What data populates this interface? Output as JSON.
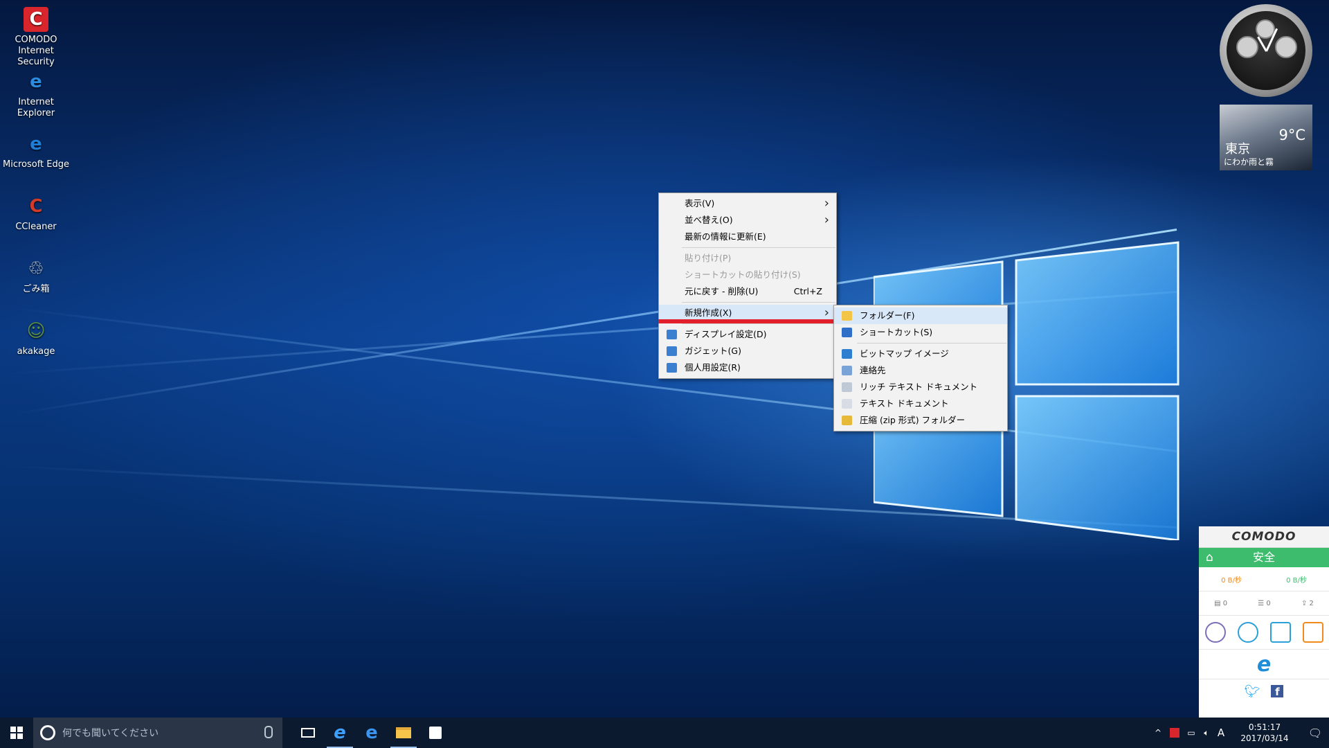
{
  "desktop_icons": [
    {
      "label": "COMODO\nInternet Security",
      "icon": "comodo-icon",
      "color": "#d9262c"
    },
    {
      "label": "Internet Explorer",
      "icon": "internet-explorer-icon",
      "color": "#2b8be0"
    },
    {
      "label": "Microsoft Edge",
      "icon": "edge-icon",
      "color": "#1f7ed6"
    },
    {
      "label": "CCleaner",
      "icon": "ccleaner-icon",
      "color": "#d23b2a"
    },
    {
      "label": "ごみ箱",
      "icon": "recycle-bin-icon",
      "color": "#cfd8e3"
    },
    {
      "label": "akakage",
      "icon": "user-icon",
      "color": "#5a8f4a"
    }
  ],
  "context_menu": {
    "items": [
      {
        "label": "表示(V)",
        "submenu": true
      },
      {
        "label": "並べ替え(O)",
        "submenu": true
      },
      {
        "label": "最新の情報に更新(E)"
      },
      {
        "separator": true
      },
      {
        "label": "貼り付け(P)",
        "disabled": true
      },
      {
        "label": "ショートカットの貼り付け(S)",
        "disabled": true
      },
      {
        "label": "元に戻す - 削除(U)",
        "accelerator": "Ctrl+Z"
      },
      {
        "separator": true
      },
      {
        "label": "新規作成(X)",
        "submenu": true,
        "highlighted": true
      },
      {
        "separator": true
      },
      {
        "label": "ディスプレイ設定(D)",
        "icon": "display-settings-icon"
      },
      {
        "label": "ガジェット(G)",
        "icon": "gadgets-icon"
      },
      {
        "label": "個人用設定(R)",
        "icon": "personalize-icon"
      }
    ]
  },
  "new_submenu": {
    "items": [
      {
        "label": "フォルダー(F)",
        "icon": "folder-icon",
        "highlighted": true
      },
      {
        "label": "ショートカット(S)",
        "icon": "shortcut-icon"
      },
      {
        "separator": true
      },
      {
        "label": "ビットマップ イメージ",
        "icon": "bitmap-icon"
      },
      {
        "label": "連絡先",
        "icon": "contact-icon"
      },
      {
        "label": "リッチ テキスト ドキュメント",
        "icon": "rich-text-icon"
      },
      {
        "label": "テキスト ドキュメント",
        "icon": "text-document-icon"
      },
      {
        "label": "圧縮 (zip 形式) フォルダー",
        "icon": "zip-folder-icon"
      }
    ]
  },
  "weather": {
    "city": "東京",
    "temp": "9°C",
    "desc": "にわか雨と霧"
  },
  "comodo": {
    "title": "COMODO",
    "status": "安全",
    "stat_left": "0 B/秒",
    "stat_right": "0 B/秒",
    "count_1": "0",
    "count_2": "0",
    "count_3": "2"
  },
  "taskbar": {
    "search_placeholder": "何でも聞いてください",
    "ime": "A",
    "time": "0:51:17",
    "date": "2017/03/14"
  }
}
